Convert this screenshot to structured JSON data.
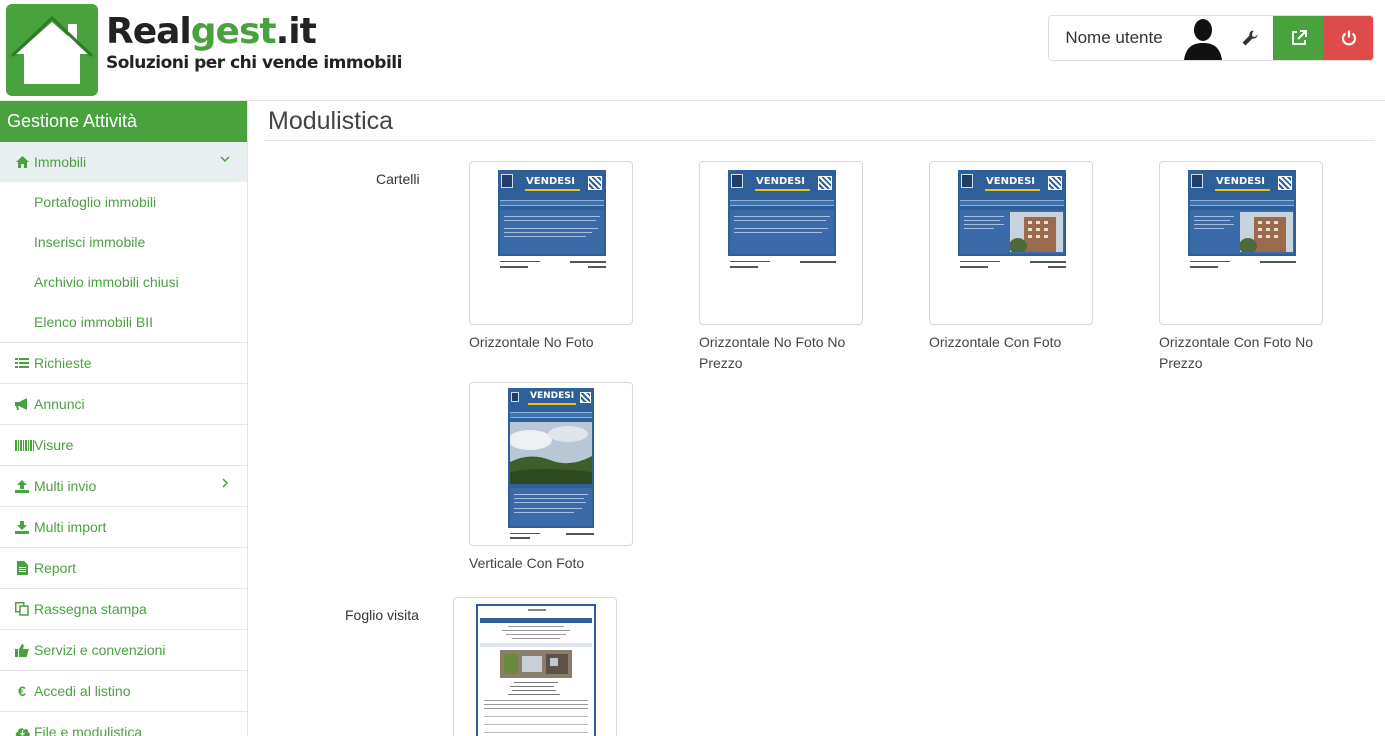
{
  "brand": {
    "name_part1": "Real",
    "name_part2": "gest",
    "name_part3": ".it",
    "tagline": "Soluzioni per chi vende immobili",
    "accent_color": "#4aa23f"
  },
  "userbar": {
    "username": "Nome utente",
    "icons": [
      "avatar-icon",
      "wrench-icon",
      "external-link-icon",
      "power-icon"
    ]
  },
  "sidebar": {
    "title": "Gestione Attività",
    "immobili": {
      "label": "Immobili",
      "icon": "home-icon",
      "subitems": [
        "Portafoglio immobili",
        "Inserisci immobile",
        "Archivio immobili chiusi",
        "Elenco immobili BII"
      ]
    },
    "items": [
      {
        "label": "Richieste",
        "icon": "list-icon"
      },
      {
        "label": "Annunci",
        "icon": "megaphone-icon"
      },
      {
        "label": "Visure",
        "icon": "barcode-icon"
      },
      {
        "label": "Multi invio",
        "icon": "upload-icon"
      },
      {
        "label": "Multi import",
        "icon": "download-icon"
      },
      {
        "label": "Report",
        "icon": "file-icon"
      },
      {
        "label": "Rassegna stampa",
        "icon": "copy-icon"
      },
      {
        "label": "Servizi e convenzioni",
        "icon": "thumbs-up-icon"
      },
      {
        "label": "Accedi al listino",
        "icon": "euro-icon"
      },
      {
        "label": "File e modulistica",
        "icon": "cloud-download-icon"
      }
    ]
  },
  "main": {
    "title": "Modulistica",
    "sections": {
      "cartelli": {
        "label": "Cartelli",
        "cards": [
          {
            "label": "Orizzontale No Foto"
          },
          {
            "label": "Orizzontale No Foto No Prezzo"
          },
          {
            "label": "Orizzontale Con Foto"
          },
          {
            "label": "Orizzontale Con Foto No Prezzo"
          },
          {
            "label": "Verticale Con Foto"
          }
        ],
        "poster_word": "VENDESI"
      },
      "foglio_visita": {
        "label": "Foglio visita"
      }
    }
  }
}
